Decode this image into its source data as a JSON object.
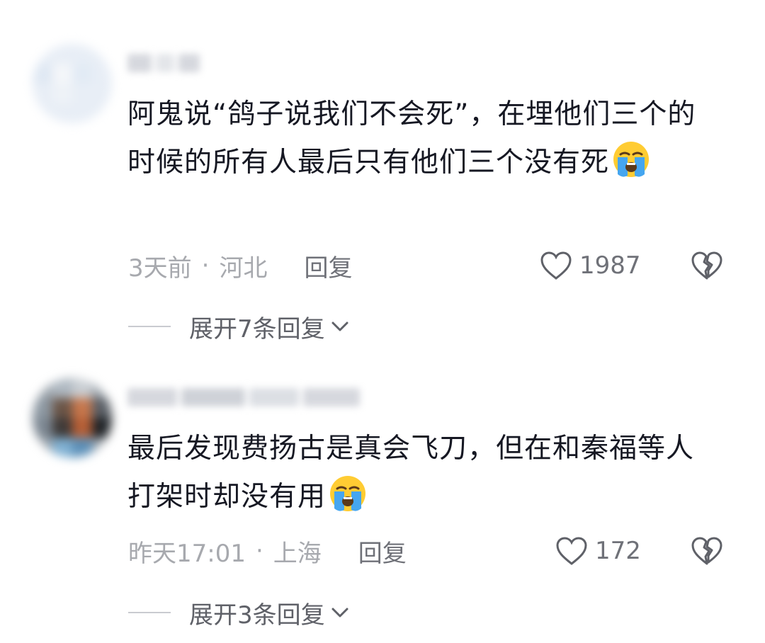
{
  "comments": [
    {
      "text": "阿鬼说“鸽子说我们不会死”，在埋他们三个的时候的所有人最后只有他们三个没有死",
      "emoji": "loudly-crying-face-emoji",
      "time": "3天前",
      "separator": "·",
      "location": "河北",
      "reply_label": "回复",
      "like_count": "1987",
      "expand_label": "展开7条回复"
    },
    {
      "text": "最后发现费扬古是真会飞刀，但在和秦福等人打架时却没有用",
      "emoji": "loudly-crying-face-emoji",
      "time": "昨天17:01",
      "separator": "·",
      "location": "上海",
      "reply_label": "回复",
      "like_count": "172",
      "expand_label": "展开3条回复"
    }
  ],
  "icons": {
    "like": "heart-outline-icon",
    "dislike": "broken-heart-icon",
    "expand": "chevron-down-icon"
  },
  "colors": {
    "text": "#161823",
    "meta": "#a7a9ae",
    "action": "#6f7178"
  }
}
